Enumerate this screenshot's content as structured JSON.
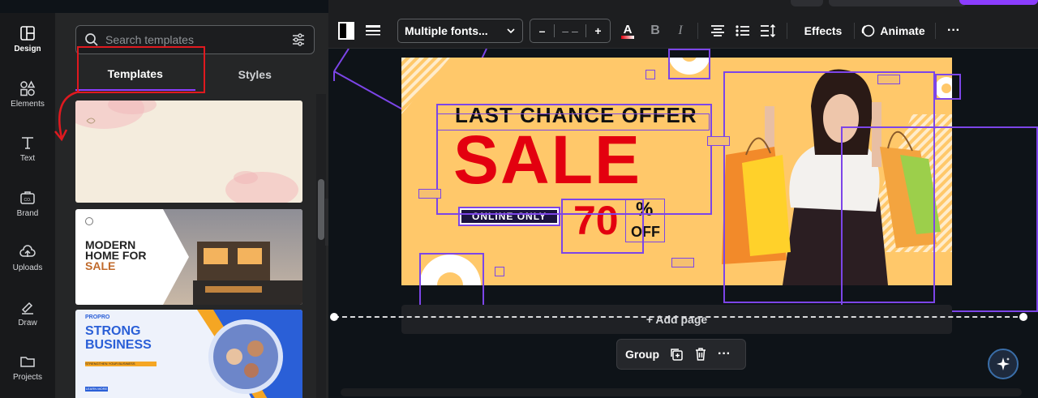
{
  "rail": {
    "items": [
      {
        "label": "Design",
        "icon": "design-icon"
      },
      {
        "label": "Elements",
        "icon": "elements-icon"
      },
      {
        "label": "Text",
        "icon": "text-icon"
      },
      {
        "label": "Brand",
        "icon": "brand-icon"
      },
      {
        "label": "Uploads",
        "icon": "uploads-icon"
      },
      {
        "label": "Draw",
        "icon": "draw-icon"
      },
      {
        "label": "Projects",
        "icon": "projects-icon"
      }
    ]
  },
  "panel": {
    "search_placeholder": "Search templates",
    "tabs": [
      {
        "label": "Templates"
      },
      {
        "label": "Styles"
      }
    ],
    "templates": [
      {
        "name": "watercolor-blank"
      },
      {
        "title_lines": [
          "MODERN",
          "HOME FOR"
        ],
        "accent": "SALE"
      },
      {
        "brand": "PROPRO",
        "title_lines": [
          "STRONG",
          "BUSINESS"
        ],
        "subline": "STRENGTHEN YOUR BUSINESS IMMEDIATELY",
        "cta": "LEARN MORE"
      }
    ]
  },
  "toolbar": {
    "font": "Multiple fonts...",
    "size_minus": "–",
    "size_value": "– –",
    "size_plus": "+",
    "bold": "B",
    "italic": "I",
    "effects": "Effects",
    "animate": "Animate",
    "more": "···"
  },
  "design": {
    "headline": "LAST CHANCE OFFER",
    "sale": "SALE",
    "badge": "ONLINE ONLY",
    "percent": "70",
    "percent_sign": "%",
    "off": "OFF"
  },
  "canvas": {
    "add_page": "+ Add page",
    "group_label": "Group",
    "more": "···"
  },
  "colors": {
    "accent": "#8b3dff",
    "selection": "#7c45e8",
    "sale_red": "#e3000f",
    "banner_bg": "#ffc86a"
  }
}
